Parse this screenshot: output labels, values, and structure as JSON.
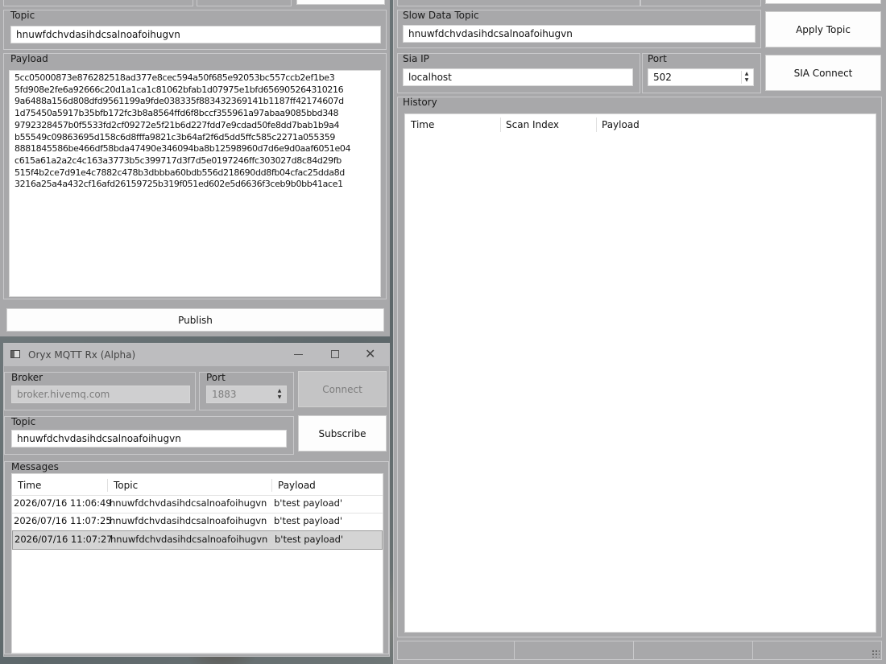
{
  "tx": {
    "topic_label": "Topic",
    "topic_value": "hnuwfdchvdasihdcsalnoafoihugvn",
    "payload_label": "Payload",
    "payload_lines": [
      "5cc05000873e876282518ad377e8cec594a50f685e92053bc557ccb2ef1be3",
      "5fd908e2fe6a92666c20d1a1ca1c81062bfab1d07975e1bfd656905264310216",
      "9a6488a156d808dfd9561199a9fde038335f883432369141b1187ff42174607d",
      "1d75450a5917b35bfb172fc3b8a8564ffd6f8bccf355961a97abaa9085bbd348",
      "9792328457b0f5533fd2cf09272e5f21b6d227fdd7e9cdad50fe8dd7bab1b9a4",
      "b55549c09863695d158c6d8fffa9821c3b64af2f6d5dd5ffc585c2271a055359",
      "8881845586be466df58bda47490e346094ba8b12598960d7d6e9d0aaf6051e04",
      "c615a61a2a2c4c163a3773b5c399717d3f7d5e0197246ffc303027d8c84d29fb",
      "515f4b2ce7d91e4c7882c478b3dbbba60bdb556d218690dd8fb04cfac25dda8d",
      "3216a25a4a432cf16afd26159725b319f051ed602e5d6636f3ceb9b0bb41ace1"
    ],
    "publish_label": "Publish"
  },
  "rx": {
    "window_title": "Oryx MQTT Rx (Alpha)",
    "broker_label": "Broker",
    "broker_value": "broker.hivemq.com",
    "port_label": "Port",
    "port_value": "1883",
    "connect_label": "Connect",
    "topic_label": "Topic",
    "topic_value": "hnuwfdchvdasihdcsalnoafoihugvn",
    "subscribe_label": "Subscribe",
    "messages_label": "Messages",
    "columns": [
      "Time",
      "Topic",
      "Payload"
    ],
    "rows": [
      {
        "time": "2026/07/16 11:06:49",
        "topic": "hnuwfdchvdasihdcsalnoafoihugvn",
        "payload": "b'test payload'"
      },
      {
        "time": "2026/07/16 11:07:25",
        "topic": "hnuwfdchvdasihdcsalnoafoihugvn",
        "payload": "b'test payload'"
      },
      {
        "time": "2026/07/16 11:07:27",
        "topic": "hnuwfdchvdasihdcsalnoafoihugvn",
        "payload": "b'test payload'"
      }
    ]
  },
  "sia": {
    "slow_topic_label": "Slow Data Topic",
    "slow_topic_value": "hnuwfdchvdasihdcsalnoafoihugvn",
    "apply_topic_label": "Apply Topic",
    "sia_ip_label": "Sia IP",
    "sia_ip_value": "localhost",
    "port_label": "Port",
    "port_value": "502",
    "sia_connect_label": "SIA Connect",
    "history_label": "History",
    "history_columns": [
      "Time",
      "Scan Index",
      "Payload"
    ]
  },
  "icons": {
    "app": "app-window-icon",
    "minimize": "minimize-icon",
    "maximize": "maximize-icon",
    "close": "close-icon",
    "spin_up": "chevron-up-icon",
    "spin_down": "chevron-down-icon",
    "grip": "resize-grip-icon"
  }
}
